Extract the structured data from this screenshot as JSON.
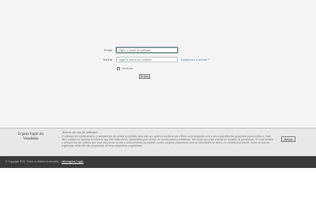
{
  "login": {
    "email_label": "Email",
    "email_placeholder": "Digite o email do software",
    "password_label": "Senha",
    "password_placeholder": "Digite a senha do software",
    "forgot_link": "Esqueceu a senha ?",
    "remember_label": "Lembrar",
    "submit_label": "Entrar"
  },
  "banner": {
    "title": "Ir para login do Vendedor",
    "terms_heading": "Termos de uso do software:",
    "terms_text": "O software de monitoramento e rastreamento de celular é projetado para pais que querem monitorar seus filhos ou empregados com o seu consentimento apropriado para monitorar. Você deve notificar os usuários do telefone que eles estão sendo monitorados pelo serviço de monitoramento a distância. Não fazer isso pode resultar em invasão de privacidade. Se você instalar o software em um telefone que você não possui ou tem o consentimento apropriado, somos cooperar plenamente com as autoridades de direito, na medida do possível. Todas as marcas registradas neste site são propriedade de seus respectivos proprietários.",
    "dismiss_label": "Baixar"
  },
  "footer": {
    "copyright": "© Copyright 2020. Todos os direitos reservados.",
    "legal_link": "Informações Legais"
  }
}
